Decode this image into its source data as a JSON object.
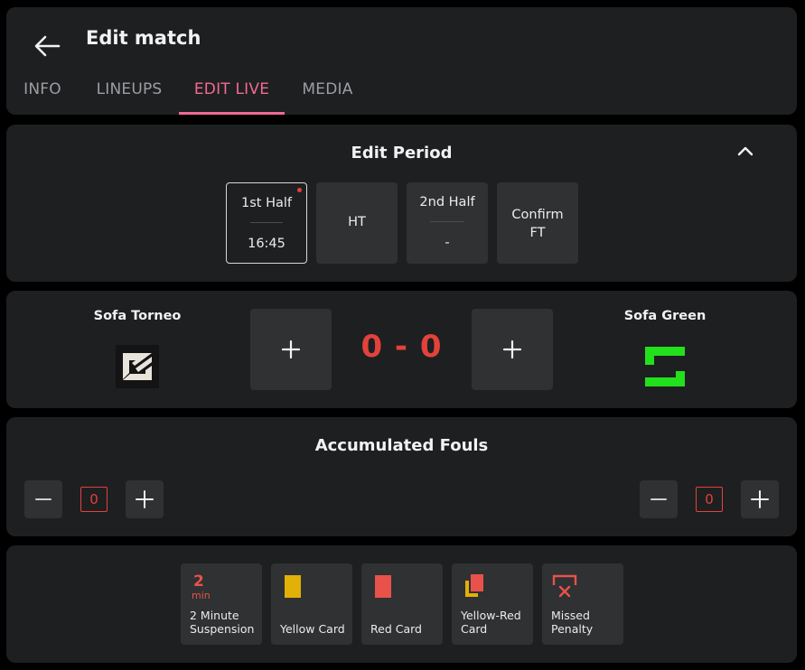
{
  "header": {
    "title": "Edit match",
    "tabs": [
      {
        "label": "INFO",
        "active": false
      },
      {
        "label": "LINEUPS",
        "active": false
      },
      {
        "label": "EDIT LIVE",
        "active": true
      },
      {
        "label": "MEDIA",
        "active": false
      }
    ]
  },
  "period": {
    "title": "Edit Period",
    "buttons": [
      {
        "label": "1st Half",
        "time": "16:45",
        "selected": true,
        "live": true
      },
      {
        "label": "HT"
      },
      {
        "label": "2nd Half",
        "time": "-"
      },
      {
        "label_line1": "Confirm",
        "label_line2": "FT"
      }
    ]
  },
  "score": {
    "home_team": "Sofa Torneo",
    "away_team": "Sofa Green",
    "display": "0 - 0",
    "home": 0,
    "away": 0
  },
  "fouls": {
    "title": "Accumulated Fouls",
    "home_count": "0",
    "away_count": "0"
  },
  "incidents": {
    "items": [
      {
        "icon": "two-minute-icon",
        "icon_num": "2",
        "icon_unit": "min",
        "label_line1": "2 Minute",
        "label_line2": "Suspension"
      },
      {
        "icon": "yellow-card-icon",
        "label_line1": "",
        "label_line2": "Yellow Card"
      },
      {
        "icon": "red-card-icon",
        "label_line1": "",
        "label_line2": "Red Card"
      },
      {
        "icon": "yellow-red-card-icon",
        "label_line1": "Yellow-Red",
        "label_line2": "Card"
      },
      {
        "icon": "missed-penalty-icon",
        "label_line1": "Missed",
        "label_line2": "Penalty"
      }
    ]
  },
  "colors": {
    "accent": "#f06a94",
    "score": "#e2423b",
    "yellow_card": "#e2b007",
    "red_card": "#e8524a",
    "away_logo": "#23e01d"
  }
}
